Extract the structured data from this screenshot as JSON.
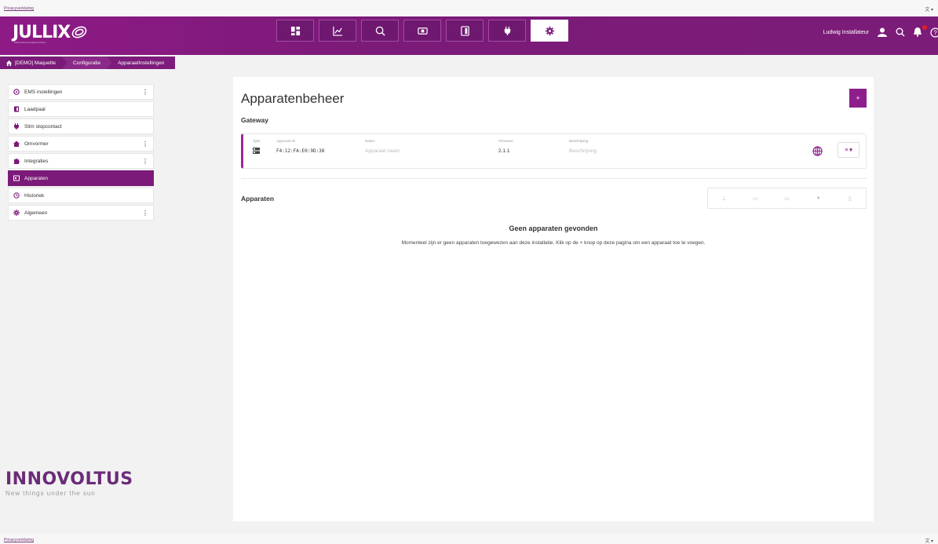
{
  "privacy_link": "Privacyverklaring",
  "language_selector": "文 ▾",
  "header": {
    "logo_text": "JULLIX",
    "logo_sub": "Maximaal energievoordeel",
    "nav_icons": [
      "dashboard-icon",
      "chart-icon",
      "analytics-icon",
      "battery-icon",
      "device-icon",
      "plug-icon",
      "gear-icon"
    ],
    "active_nav": "gear-icon",
    "user_name": "Ludwig Installateur"
  },
  "breadcrumb": {
    "items": [
      "[DEMO] Maquette",
      "Configuratie",
      "ApparaatInstellingen"
    ]
  },
  "sidebar": {
    "items": [
      {
        "label": "EMS instellingen",
        "icon": "ems-icon",
        "has_menu": true
      },
      {
        "label": "Laadpaal",
        "icon": "charger-icon",
        "has_menu": false
      },
      {
        "label": "Slim stopcontact",
        "icon": "plug-icon",
        "has_menu": false
      },
      {
        "label": "Omvormer",
        "icon": "house-icon",
        "has_menu": true
      },
      {
        "label": "Integraties",
        "icon": "puzzle-icon",
        "has_menu": true
      },
      {
        "label": "Apparaten",
        "icon": "devices-icon",
        "has_menu": false,
        "active": true
      },
      {
        "label": "Historiek",
        "icon": "history-icon",
        "has_menu": false
      },
      {
        "label": "Algemeen",
        "icon": "gear-icon",
        "has_menu": true
      }
    ],
    "dots": "⋮"
  },
  "brand": {
    "name": "INNOVOLTUS",
    "tagline": "New things under the sun"
  },
  "main": {
    "title": "Apparatenbeheer",
    "add_button": "+",
    "gateway_section": "Gateway",
    "gateway": {
      "type_label": "Type",
      "id_label": "Apparaat ID",
      "id_value": "F4:12:FA:E0:9D:38",
      "name_label": "Naam",
      "name_placeholder": "Apparaat naam",
      "firmware_label": "Firmware",
      "firmware_value": "2.1.1",
      "desc_label": "Beschrijving",
      "desc_placeholder": "Beschrijving",
      "menu_label": "≡ ▾"
    },
    "devices_section": "Apparaten",
    "empty_title": "Geen apparaten gevonden",
    "empty_desc": "Momenteel zijn er geen apparaten toegewezen aan deze installatie. Klik op de + knop op deze pagina om een apparaat toe te voegen."
  },
  "colors": {
    "brand": "#7b1a78",
    "accent": "#8e1e8c",
    "innovoltus": "#6a2c78"
  }
}
